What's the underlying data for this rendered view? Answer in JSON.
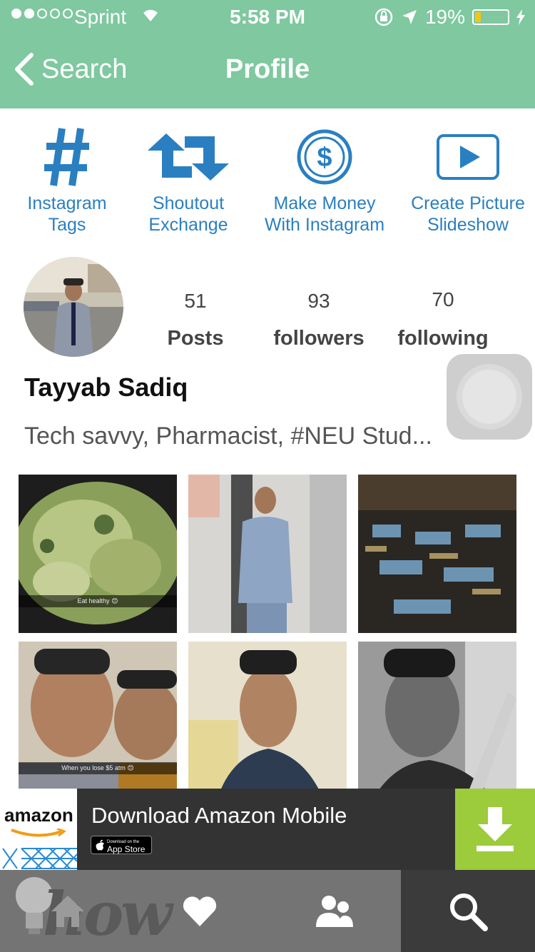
{
  "status_bar": {
    "carrier": "Sprint",
    "time": "5:58 PM",
    "battery": "19%",
    "battery_level": 0.19
  },
  "nav": {
    "back_label": "Search",
    "title": "Profile"
  },
  "tools": [
    {
      "label1": "Instagram",
      "label2": "Tags",
      "icon": "hashtag-icon"
    },
    {
      "label1": "Shoutout",
      "label2": "Exchange",
      "icon": "exchange-arrows-icon"
    },
    {
      "label1": "Make Money",
      "label2": "With Instagram",
      "icon": "dollar-circle-icon"
    },
    {
      "label1": "Create Picture",
      "label2": "Slideshow",
      "icon": "play-icon"
    }
  ],
  "profile": {
    "name": "Tayyab Sadiq",
    "bio": "Tech savvy, Pharmacist, #NEU Stud...",
    "stats": [
      {
        "count": "51",
        "label": "Posts"
      },
      {
        "count": "93",
        "label": "followers"
      },
      {
        "count": "70",
        "label": "following"
      }
    ]
  },
  "photos": [
    {
      "caption": "Eat healthy 😊"
    },
    {
      "caption": ""
    },
    {
      "caption": ""
    },
    {
      "caption": "When you lose $5 atm 😊"
    },
    {
      "caption": ""
    },
    {
      "caption": ""
    }
  ],
  "ad": {
    "brand": "amazon",
    "text": "Download Amazon Mobile",
    "badge_small": "Download on the",
    "badge_big": "App Store"
  },
  "tabbar": {
    "watermark": "how",
    "items": [
      "home-icon",
      "heart-icon",
      "people-icon",
      "search-icon"
    ],
    "selected": "search-icon"
  },
  "colors": {
    "nav": "#7fc8a0",
    "accent": "#2a7fc1",
    "ad_button": "#9ccb3b",
    "tab_selected": "#3b3b3b"
  }
}
